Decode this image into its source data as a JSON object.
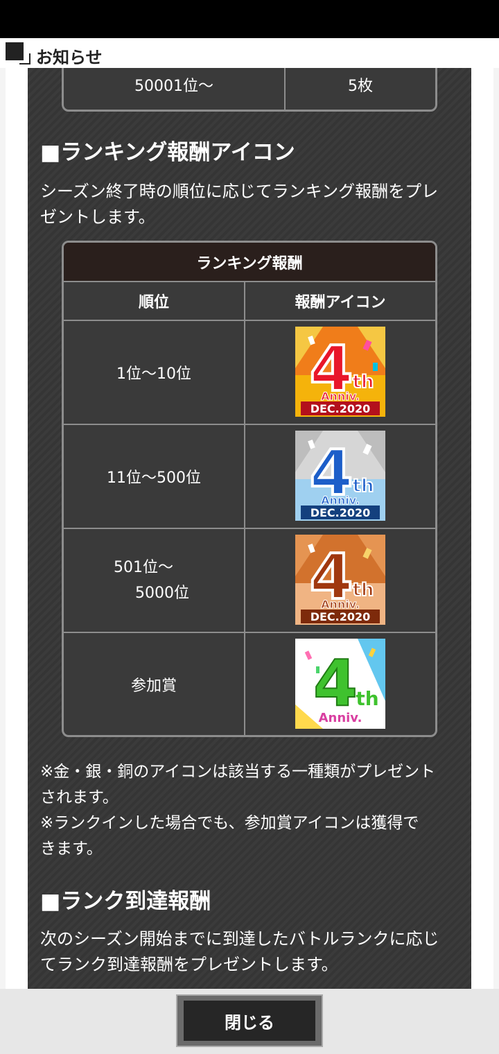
{
  "window": {
    "title": "お知らせ"
  },
  "top_table": {
    "rank": "50001位～",
    "reward": "5枚"
  },
  "section1": {
    "heading": "■ランキング報酬アイコン",
    "desc_line1": "シーズン終了時の順位に応じてランキング報酬をプレ",
    "desc_line2": "ゼントします。"
  },
  "ranking_table": {
    "title": "ランキング報酬",
    "col_rank": "順位",
    "col_icon": "報酬アイコン",
    "rows": [
      {
        "rank": "1位～10位",
        "icon": "gold-4th-anniv-icon",
        "color": "#f0b400",
        "icon_text1": "Anniv.",
        "icon_text2": "DEC.2020"
      },
      {
        "rank": "11位～500位",
        "icon": "silver-4th-anniv-icon",
        "color": "#7fb8e6",
        "icon_text1": "Anniv.",
        "icon_text2": "DEC.2020"
      },
      {
        "rank_line1": "501位～",
        "rank_line2": "5000位",
        "icon": "bronze-4th-anniv-icon",
        "color": "#d27a3a",
        "icon_text1": "Anniv.",
        "icon_text2": "DEC.2020"
      },
      {
        "rank": "参加賞",
        "icon": "participation-4th-anniv-icon",
        "color": "#3fc22e",
        "icon_text1": "Anniv."
      }
    ],
    "icon_number": "4",
    "icon_suffix": "th"
  },
  "notes": {
    "line1": "※金・銀・銅のアイコンは該当する一種類がプレゼント",
    "line2": "されます。",
    "line3": "※ランクインした場合でも、参加賞アイコンは獲得で",
    "line4": "きます。"
  },
  "section2": {
    "heading": "■ランク到達報酬",
    "desc_line1": "次のシーズン開始までに到達したバトルランクに応じ",
    "desc_line2": "てランク到達報酬をプレゼントします。"
  },
  "footer": {
    "close_label": "閉じる"
  }
}
